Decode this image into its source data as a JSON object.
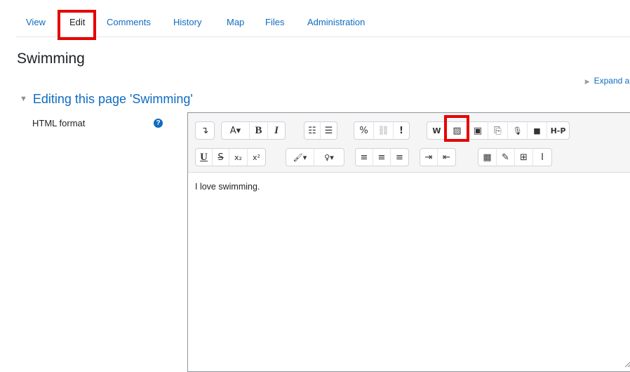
{
  "tabs": [
    {
      "label": "View"
    },
    {
      "label": "Edit"
    },
    {
      "label": "Comments"
    },
    {
      "label": "History"
    },
    {
      "label": "Map"
    },
    {
      "label": "Files"
    },
    {
      "label": "Administration"
    }
  ],
  "page_title": "Swimming",
  "expand_all_label": "Expand al",
  "section_heading": "Editing this page 'Swimming'",
  "field_label": "HTML format",
  "help_icon_glyph": "?",
  "editor_content": "I love swimming.",
  "toolbar": {
    "row1": [
      [
        "↴"
      ],
      [
        "A▾",
        "B",
        "I"
      ],
      [
        "☷",
        "☰"
      ],
      [
        "%",
        "⛓",
        "!"
      ],
      [
        "W",
        "▨",
        "▣",
        "⎘",
        "🎙",
        "■",
        "H-P"
      ]
    ],
    "row2": [
      [
        "U",
        "S",
        "x₂",
        "x²"
      ],
      [
        "🖌▾",
        "♀▾"
      ],
      [
        "≡",
        "≡",
        "≡"
      ],
      [
        "⇥",
        "⇤"
      ],
      [
        "▦",
        "✎",
        "⊞",
        "I"
      ]
    ]
  },
  "highlight_color": "#e60000",
  "link_color": "#0f6cbf"
}
